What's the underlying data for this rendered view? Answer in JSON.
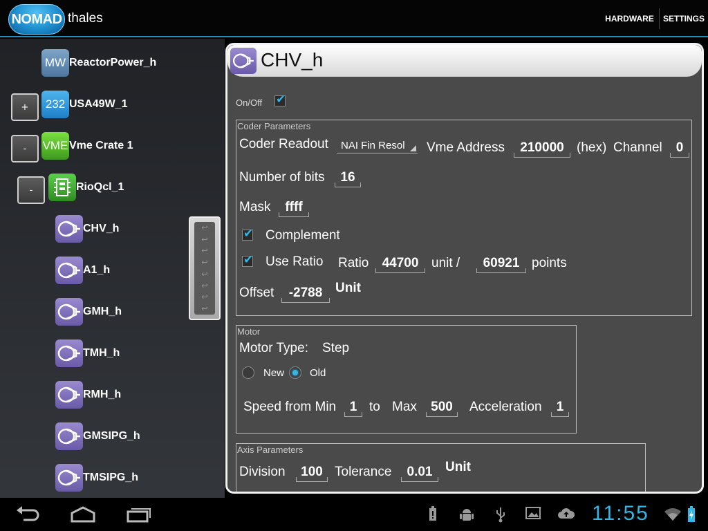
{
  "actionbar": {
    "logo": "NOMAD",
    "title": "thales",
    "buttons": [
      "HARDWARE",
      "SETTINGS"
    ]
  },
  "tree": {
    "items": [
      {
        "icon_text": "MW",
        "label": "ReactorPower_h",
        "toggle": ""
      },
      {
        "icon_text": "232",
        "label": "USA49W_1",
        "toggle": "+"
      },
      {
        "icon_text": "VME",
        "label": "Vme Crate 1",
        "toggle": "-"
      },
      {
        "icon_text": "",
        "label": "RioQcl_1",
        "toggle": "-"
      },
      {
        "icon_text": "",
        "label": "CHV_h",
        "toggle": ""
      },
      {
        "icon_text": "",
        "label": "A1_h",
        "toggle": ""
      },
      {
        "icon_text": "",
        "label": "GMH_h",
        "toggle": ""
      },
      {
        "icon_text": "",
        "label": "TMH_h",
        "toggle": ""
      },
      {
        "icon_text": "",
        "label": "RMH_h",
        "toggle": ""
      },
      {
        "icon_text": "",
        "label": "GMSIPG_h",
        "toggle": ""
      },
      {
        "icon_text": "",
        "label": "TMSIPG_h",
        "toggle": ""
      }
    ]
  },
  "detail": {
    "title": "CHV_h",
    "onoff_label": "On/Off",
    "coder": {
      "group_title": "Coder Parameters",
      "readout_label": "Coder Readout",
      "readout_value": "NAI Fin Resol",
      "vme_address_label": "Vme Address",
      "vme_address": "210000",
      "hex_label": "(hex)",
      "channel_label": "Channel",
      "channel": "0",
      "bits_label": "Number of bits",
      "bits": "16",
      "mask_label": "Mask",
      "mask": "ffff",
      "complement_label": "Complement",
      "use_ratio_label": "Use Ratio",
      "ratio_label": "Ratio",
      "ratio_units": "44700",
      "unit_label": "unit /",
      "ratio_points": "60921",
      "points_label": "points",
      "offset_label": "Offset",
      "offset": "-2788",
      "offset_unit": "Unit"
    },
    "motor": {
      "group_title": "Motor",
      "type_label": "Motor Type:",
      "type_value": "Step",
      "new_label": "New",
      "old_label": "Old",
      "speed_label": "Speed from Min",
      "speed_min": "1",
      "to_label": "to",
      "max_label": "Max",
      "speed_max": "500",
      "accel_label": "Acceleration",
      "accel": "1"
    },
    "axis": {
      "group_title": "Axis Parameters",
      "division_label": "Division",
      "division": "100",
      "tolerance_label": "Tolerance",
      "tolerance": "0.01",
      "unit_label": "Unit"
    }
  },
  "system": {
    "clock": "11:55"
  },
  "colors": {
    "accent": "#33b5e5",
    "panel": "#4a4a4a"
  }
}
